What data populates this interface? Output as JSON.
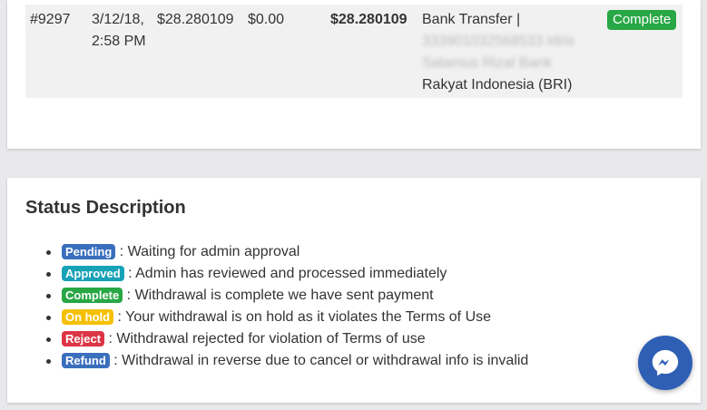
{
  "colors": {
    "pending": "#3a6fbe",
    "approved": "#17a2b8",
    "complete": "#28a745",
    "onhold": "#f5c000",
    "reject": "#dc3545",
    "refund": "#3a6fbe",
    "messenger": "#2e5fb4"
  },
  "transaction": {
    "id": "#9297",
    "date_line1": "3/12/18,",
    "date_line2": "2:58 PM",
    "amount": "$28.280109",
    "fee": "$0.00",
    "net": "$28.280109",
    "method_line1": "Bank Transfer |",
    "method_blur1": "333901032568533 Idris",
    "method_blur2": "Salamus Rizal Bank",
    "method_line4": "Rakyat Indonesia (BRI)",
    "status": "Complete"
  },
  "status_description": {
    "title": "Status Description",
    "items": [
      {
        "badge": "Pending",
        "text": " : Waiting for admin approval"
      },
      {
        "badge": "Approved",
        "text": " : Admin has reviewed and processed immediately"
      },
      {
        "badge": "Complete",
        "text": " : Withdrawal is complete we have sent payment"
      },
      {
        "badge": "On hold",
        "text": " : Your withdrawal is on hold as it violates the Terms of Use"
      },
      {
        "badge": "Reject",
        "text": " : Withdrawal rejected for violation of Terms of use"
      },
      {
        "badge": "Refund",
        "text": " : Withdrawal in reverse due to cancel or withdrawal info is invalid"
      }
    ]
  },
  "messenger_icon": "messenger-icon"
}
